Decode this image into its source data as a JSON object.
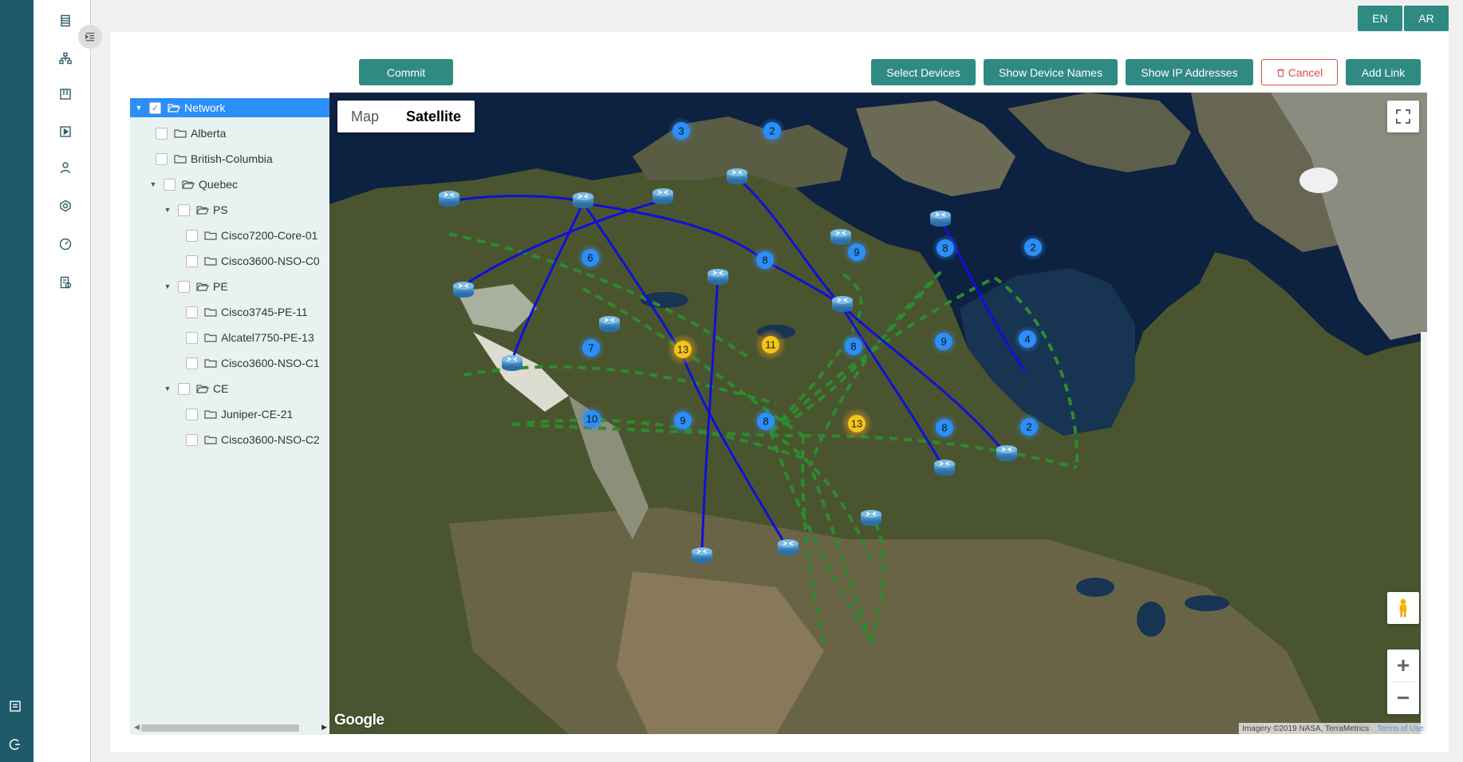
{
  "lang": {
    "en": "EN",
    "ar": "AR"
  },
  "toolbar": {
    "commit": "Commit",
    "select_devices": "Select Devices",
    "show_device_names": "Show Device Names",
    "show_ip_addresses": "Show IP Addresses",
    "cancel": "Cancel",
    "add_link": "Add Link"
  },
  "tree": {
    "root": "Network",
    "alberta": "Alberta",
    "bc": "British-Columbia",
    "quebec": "Quebec",
    "ps": "PS",
    "ps_1": "Cisco7200-Core-01",
    "ps_2": "Cisco3600-NSO-C0",
    "pe": "PE",
    "pe_1": "Cisco3745-PE-11",
    "pe_2": "Alcatel7750-PE-13",
    "pe_3": "Cisco3600-NSO-C1",
    "ce": "CE",
    "ce_1": "Juniper-CE-21",
    "ce_2": "Cisco3600-NSO-C2"
  },
  "map": {
    "tab_map": "Map",
    "tab_satellite": "Satellite",
    "google": "Google",
    "attribution": "Imagery ©2019 NASA, TerraMetrics",
    "terms": "Terms of Use",
    "clusters": [
      {
        "count": "3",
        "color": "#2c8ef8"
      },
      {
        "count": "2",
        "color": "#2c8ef8"
      },
      {
        "count": "6",
        "color": "#2c8ef8"
      },
      {
        "count": "8",
        "color": "#2c8ef8"
      },
      {
        "count": "9",
        "color": "#2c8ef8"
      },
      {
        "count": "8",
        "color": "#2c8ef8"
      },
      {
        "count": "2",
        "color": "#2c8ef8"
      },
      {
        "count": "7",
        "color": "#2c8ef8"
      },
      {
        "count": "13",
        "color": "#f5c518"
      },
      {
        "count": "11",
        "color": "#f5c518"
      },
      {
        "count": "8",
        "color": "#2c8ef8"
      },
      {
        "count": "9",
        "color": "#2c8ef8"
      },
      {
        "count": "4",
        "color": "#2c8ef8"
      },
      {
        "count": "10",
        "color": "#2c8ef8"
      },
      {
        "count": "9",
        "color": "#2c8ef8"
      },
      {
        "count": "8",
        "color": "#2c8ef8"
      },
      {
        "count": "13",
        "color": "#f5c518"
      },
      {
        "count": "8",
        "color": "#2c8ef8"
      },
      {
        "count": "2",
        "color": "#2c8ef8"
      }
    ],
    "link_solid_color": "#1010d8",
    "link_dashed_color": "#2e8b2e"
  }
}
